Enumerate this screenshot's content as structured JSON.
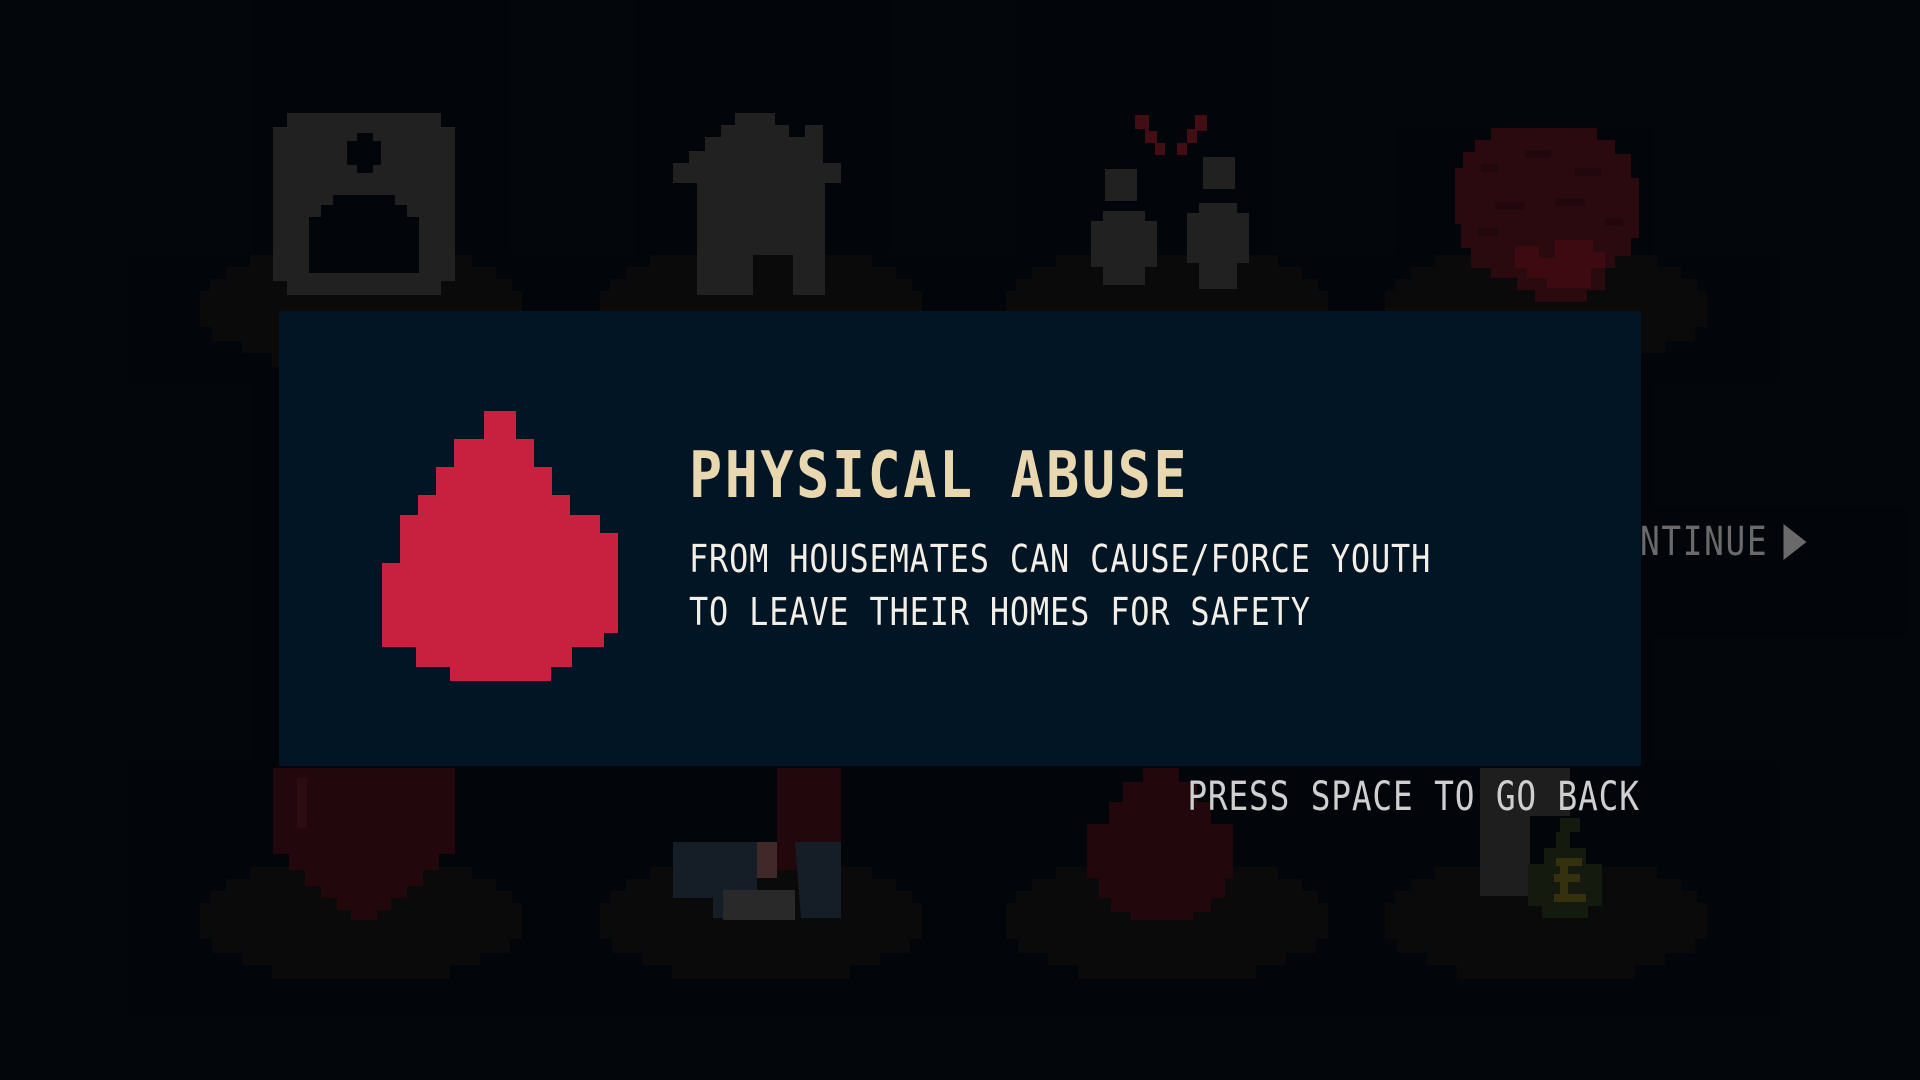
{
  "modal": {
    "title": "PHYSICAL ABUSE",
    "description": "FROM HOUSEMATES CAN CAUSE/FORCE YOUTH TO LEAVE THEIR HOMES FOR SAFETY",
    "icon": "blood-drop-icon",
    "back_hint": "PRESS SPACE TO GO BACK"
  },
  "navigation": {
    "continue_label": "NTINUE",
    "continue_icon": "play-triangle-icon"
  },
  "topics": [
    {
      "id": "person",
      "icon": "person-frame-icon"
    },
    {
      "id": "home",
      "icon": "house-icon"
    },
    {
      "id": "conflict",
      "icon": "conflict-people-icon"
    },
    {
      "id": "mind",
      "icon": "brain-icon"
    },
    {
      "id": "love",
      "icon": "heart-icon"
    },
    {
      "id": "substances",
      "icon": "syringe-icon"
    },
    {
      "id": "physical-abuse",
      "icon": "blood-drop-icon"
    },
    {
      "id": "money",
      "icon": "money-bag-icon"
    }
  ],
  "colors": {
    "background": "#04090e",
    "dialog": "#011524",
    "title": "#e9d7b0",
    "text": "#f3efe6",
    "drop": "#c8213f"
  }
}
